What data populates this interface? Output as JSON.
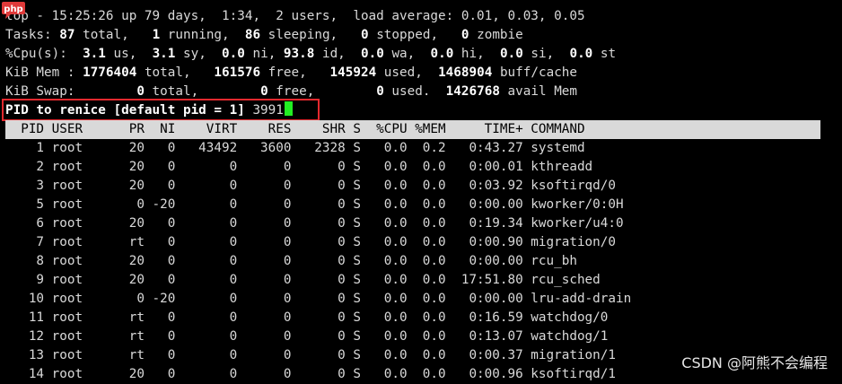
{
  "summary": {
    "top": "top - 15:25:26 up 79 days,  1:34,  2 users,  load average: 0.01, 0.03, 0.05",
    "tasks_label": "Tasks: ",
    "tasks_total": "87",
    "tasks_total_lbl": " total,   ",
    "tasks_running": "1",
    "tasks_running_lbl": " running,  ",
    "tasks_sleeping": "86",
    "tasks_sleeping_lbl": " sleeping,   ",
    "tasks_stopped": "0",
    "tasks_stopped_lbl": " stopped,   ",
    "tasks_zombie": "0",
    "tasks_zombie_lbl": " zombie",
    "cpu_label": "%Cpu(s):  ",
    "cpu_us": "3.1",
    "cpu_us_lbl": " us,  ",
    "cpu_sy": "3.1",
    "cpu_sy_lbl": " sy,  ",
    "cpu_ni": "0.0",
    "cpu_ni_lbl": " ni, ",
    "cpu_id": "93.8",
    "cpu_id_lbl": " id,  ",
    "cpu_wa": "0.0",
    "cpu_wa_lbl": " wa,  ",
    "cpu_hi": "0.0",
    "cpu_hi_lbl": " hi,  ",
    "cpu_si": "0.0",
    "cpu_si_lbl": " si,  ",
    "cpu_st": "0.0",
    "cpu_st_lbl": " st",
    "mem_label": "KiB Mem : ",
    "mem_total": "1776404",
    "mem_total_lbl": " total,   ",
    "mem_free": "161576",
    "mem_free_lbl": " free,   ",
    "mem_used": "145924",
    "mem_used_lbl": " used,  ",
    "mem_buff": "1468904",
    "mem_buff_lbl": " buff/cache",
    "swap_label": "KiB Swap:        ",
    "swap_total": "0",
    "swap_total_lbl": " total,        ",
    "swap_free": "0",
    "swap_free_lbl": " free,        ",
    "swap_used": "0",
    "swap_used_lbl": " used.  ",
    "swap_avail": "1426768",
    "swap_avail_lbl": " avail Mem"
  },
  "prompt": {
    "label": "PID to renice [default pid = 1] ",
    "value": "3991"
  },
  "header": "  PID USER      PR  NI    VIRT    RES    SHR S  %CPU %MEM     TIME+ COMMAND",
  "processes": [
    "    1 root      20   0   43492   3600   2328 S   0.0  0.2   0:43.27 systemd",
    "    2 root      20   0       0      0      0 S   0.0  0.0   0:00.01 kthreadd",
    "    3 root      20   0       0      0      0 S   0.0  0.0   0:03.92 ksoftirqd/0",
    "    5 root       0 -20       0      0      0 S   0.0  0.0   0:00.00 kworker/0:0H",
    "    6 root      20   0       0      0      0 S   0.0  0.0   0:19.34 kworker/u4:0",
    "    7 root      rt   0       0      0      0 S   0.0  0.0   0:00.90 migration/0",
    "    8 root      20   0       0      0      0 S   0.0  0.0   0:00.00 rcu_bh",
    "    9 root      20   0       0      0      0 S   0.0  0.0  17:51.80 rcu_sched",
    "   10 root       0 -20       0      0      0 S   0.0  0.0   0:00.00 lru-add-drain",
    "   11 root      rt   0       0      0      0 S   0.0  0.0   0:16.59 watchdog/0",
    "   12 root      rt   0       0      0      0 S   0.0  0.0   0:13.07 watchdog/1",
    "   13 root      rt   0       0      0      0 S   0.0  0.0   0:00.37 migration/1",
    "   14 root      20   0       0      0      0 S   0.0  0.0   0:00.96 ksoftirqd/1"
  ],
  "logo_text": "php",
  "watermark": "CSDN @阿熊不会编程",
  "colors": {
    "highlight": "#e4292e",
    "cursor": "#22ee22",
    "header_bg": "#d9d9d9"
  }
}
